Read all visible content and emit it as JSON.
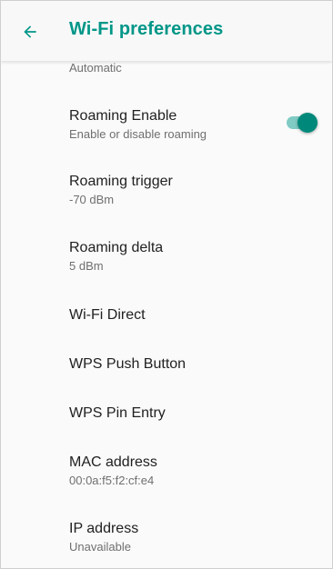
{
  "header": {
    "title": "Wi-Fi preferences",
    "back_icon": "arrow-back-icon"
  },
  "colors": {
    "accent": "#009688",
    "toggle_thumb": "#00897b",
    "toggle_track": "#80cbc4"
  },
  "settings": {
    "partial": {
      "summary": "Automatic"
    },
    "roaming_enable": {
      "title": "Roaming Enable",
      "summary": "Enable or disable roaming",
      "enabled": true
    },
    "roaming_trigger": {
      "title": "Roaming trigger",
      "summary": "-70 dBm"
    },
    "roaming_delta": {
      "title": "Roaming delta",
      "summary": "5 dBm"
    },
    "wifi_direct": {
      "title": "Wi-Fi Direct"
    },
    "wps_push": {
      "title": "WPS Push Button"
    },
    "wps_pin": {
      "title": "WPS Pin Entry"
    },
    "mac_address": {
      "title": "MAC address",
      "summary": "00:0a:f5:f2:cf:e4"
    },
    "ip_address": {
      "title": "IP address",
      "summary": "Unavailable"
    }
  }
}
